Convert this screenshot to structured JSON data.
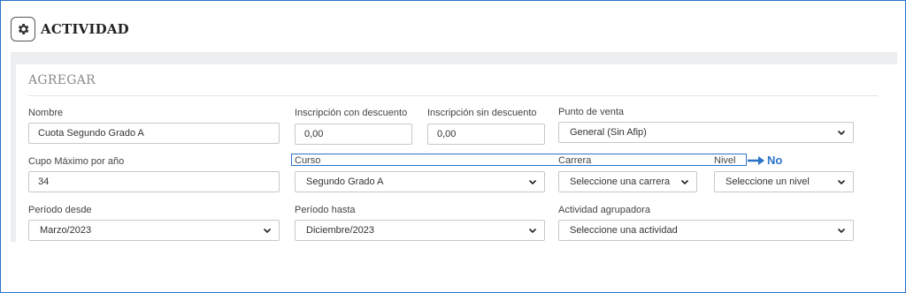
{
  "header": {
    "title": "ACTIVIDAD",
    "icon": "gear-icon"
  },
  "section": {
    "title": "AGREGAR"
  },
  "fields": {
    "nombre": {
      "label": "Nombre",
      "value": "Cuota Segundo Grado A"
    },
    "insc_con": {
      "label": "Inscripción con descuento",
      "value": "0,00"
    },
    "insc_sin": {
      "label": "Inscripción sin descuento",
      "value": "0,00"
    },
    "punto_venta": {
      "label": "Punto de venta",
      "value": "General (Sin Afip)"
    },
    "cupo": {
      "label": "Cupo Máximo por año",
      "value": "34"
    },
    "curso": {
      "label": "Curso",
      "value": "Segundo Grado A"
    },
    "carrera": {
      "label": "Carrera",
      "value": "Seleccione una carrera"
    },
    "nivel": {
      "label": "Nivel",
      "value": "Seleccione un nivel"
    },
    "periodo_desde": {
      "label": "Período desde",
      "value": "Marzo/2023"
    },
    "periodo_hasta": {
      "label": "Período hasta",
      "value": "Diciembre/2023"
    },
    "actividad_agrupadora": {
      "label": "Actividad agrupadora",
      "value": "Seleccione una actividad"
    }
  },
  "annotation": {
    "text": "No",
    "color": "#2a73c7"
  }
}
